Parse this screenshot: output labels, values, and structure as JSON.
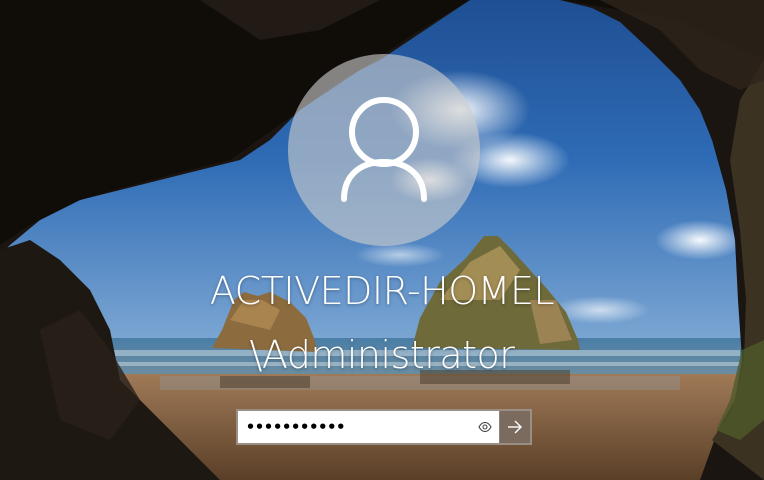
{
  "user": {
    "name_line1": "ACTIVEDIR-HOMEL",
    "name_line2": "\\Administrator"
  },
  "password": {
    "value": "•••••••••••",
    "reveal_icon": "eye-icon",
    "submit_icon": "arrow-right-icon"
  },
  "colors": {
    "submit_bg": "#7b6b5e",
    "avatar_circle": "#cdcdcd",
    "text": "#ffffff"
  }
}
